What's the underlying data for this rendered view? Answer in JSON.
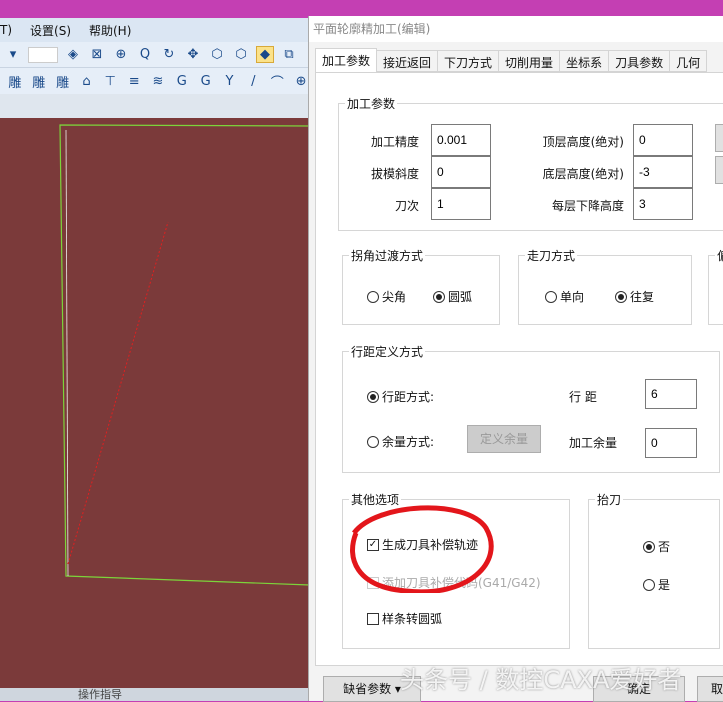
{
  "app": {
    "menu": [
      "T)",
      "设置(S)",
      "帮助(H)"
    ],
    "status": "操作指导"
  },
  "dialog": {
    "title": "平面轮廓精加工(编辑)",
    "tabs": [
      "加工参数",
      "接近返回",
      "下刀方式",
      "切削用量",
      "坐标系",
      "刀具参数",
      "几何"
    ],
    "machining": {
      "legend": "加工参数",
      "precision_label": "加工精度",
      "precision": "0.001",
      "draft_label": "拔模斜度",
      "draft": "0",
      "passes_label": "刀次",
      "passes": "1",
      "top_label": "顶层高度(绝对)",
      "top": "0",
      "bottom_label": "底层高度(绝对)",
      "bottom": "-3",
      "step_label": "每层下降高度",
      "step": "3"
    },
    "corner": {
      "legend": "拐角过渡方式",
      "opt1": "尖角",
      "opt2": "圆弧"
    },
    "path": {
      "legend": "走刀方式",
      "opt1": "单向",
      "opt2": "往复"
    },
    "offset": {
      "legend": "偏"
    },
    "spacing": {
      "legend": "行距定义方式",
      "mode1": "行距方式:",
      "mode2": "余量方式:",
      "define_btn": "定义余量",
      "spacing_label": "行  距",
      "spacing": "6",
      "allowance_label": "加工余量",
      "allowance": "0"
    },
    "other": {
      "legend": "其他选项",
      "cb1": "生成刀具补偿轨迹",
      "cb2": "添加刀具补偿代码(G41/G42)",
      "cb3": "样条转圆弧"
    },
    "lift": {
      "legend": "抬刀",
      "no": "否",
      "yes": "是"
    },
    "buttons": {
      "defaults": "缺省参数",
      "ok": "确定",
      "cancel": "取"
    }
  },
  "watermark": "头条号 / 数控CAXA爱好者"
}
